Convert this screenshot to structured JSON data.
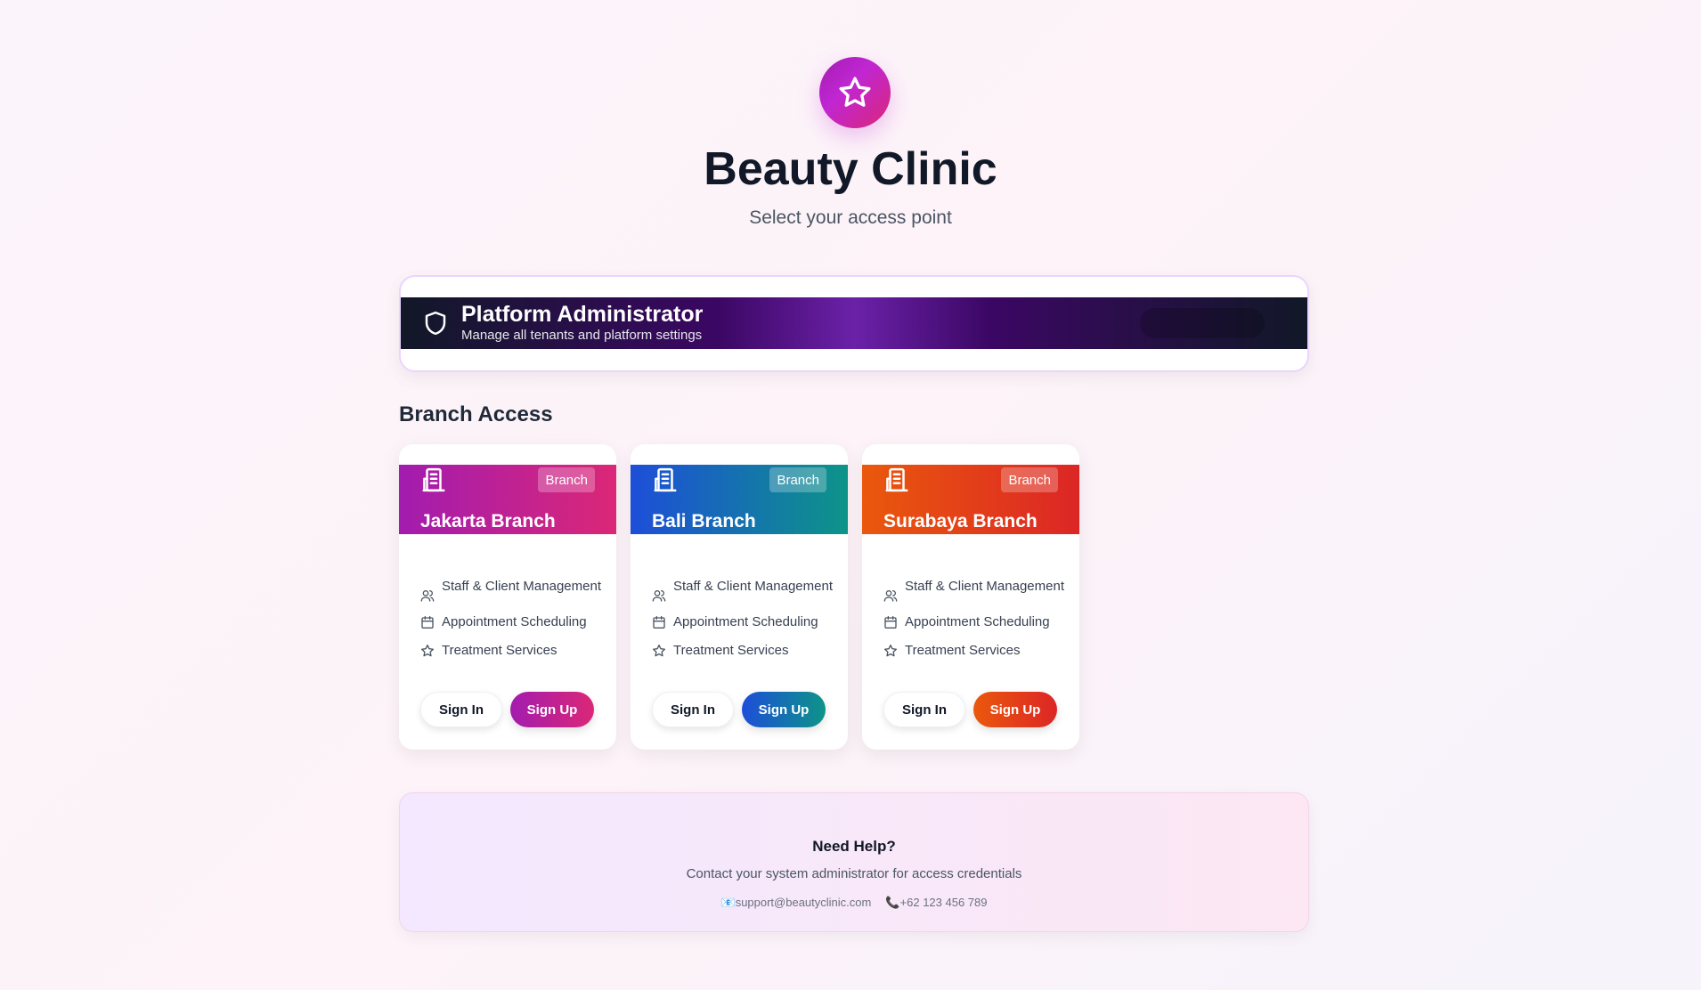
{
  "header": {
    "logo_icon": "star-icon",
    "title": "Beauty Clinic",
    "subtitle": "Select your access point"
  },
  "admin": {
    "title": "Platform Administrator",
    "subtitle": "Manage all tenants and platform settings",
    "icon": "shield-icon"
  },
  "branch_section": {
    "title": "Branch Access"
  },
  "branches": [
    {
      "name": "Jakarta Branch",
      "badge": "Branch",
      "icon": "building-icon",
      "gradient": [
        "#a21caf",
        "#db2777"
      ],
      "features": [
        "Staff & Client Management",
        "Appointment Scheduling",
        "Treatment Services"
      ],
      "sign_in": "Sign In",
      "sign_up": "Sign Up"
    },
    {
      "name": "Bali Branch",
      "badge": "Branch",
      "icon": "building-icon",
      "gradient": [
        "#1d4ed8",
        "#0d9488"
      ],
      "features": [
        "Staff & Client Management",
        "Appointment Scheduling",
        "Treatment Services"
      ],
      "sign_in": "Sign In",
      "sign_up": "Sign Up"
    },
    {
      "name": "Surabaya Branch",
      "badge": "Branch",
      "icon": "building-icon",
      "gradient": [
        "#ea580c",
        "#dc2626"
      ],
      "features": [
        "Staff & Client Management",
        "Appointment Scheduling",
        "Treatment Services"
      ],
      "sign_in": "Sign In",
      "sign_up": "Sign Up"
    }
  ],
  "help": {
    "title": "Need Help?",
    "text": "Contact your system administrator for access credentials",
    "email": "support@beautyclinic.com",
    "phone": "+62 123 456 789"
  }
}
